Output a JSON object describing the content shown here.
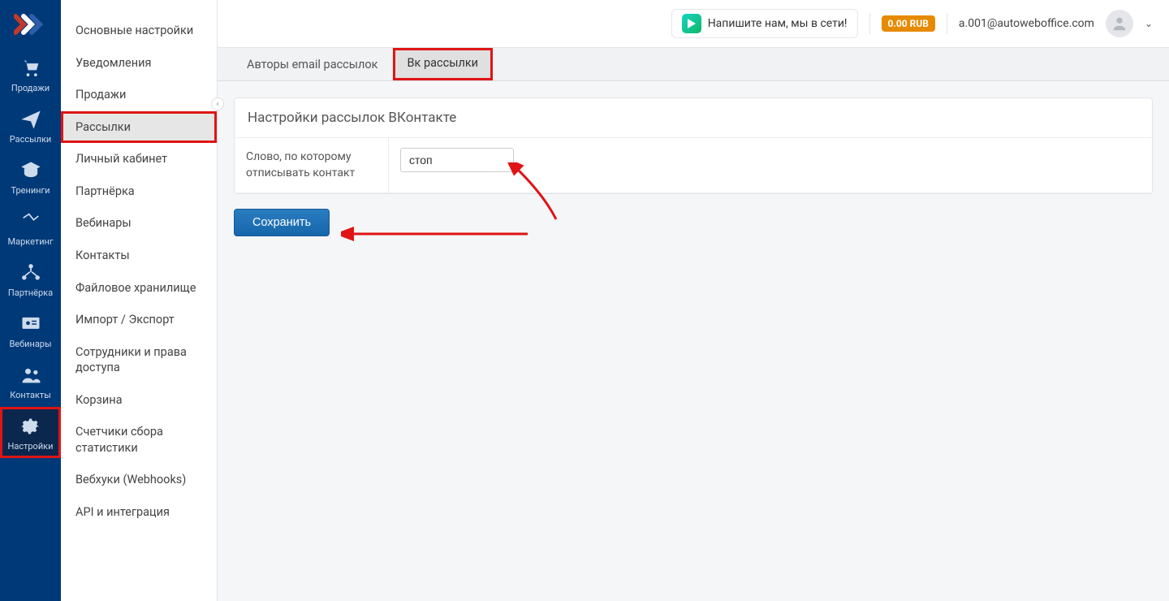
{
  "rail": [
    {
      "id": "sales",
      "label": "Продажи"
    },
    {
      "id": "mailings",
      "label": "Рассылки"
    },
    {
      "id": "trainings",
      "label": "Тренинги"
    },
    {
      "id": "marketing",
      "label": "Маркетинг"
    },
    {
      "id": "partner",
      "label": "Партнёрка"
    },
    {
      "id": "webinars",
      "label": "Вебинары"
    },
    {
      "id": "contacts",
      "label": "Контакты"
    },
    {
      "id": "settings",
      "label": "Настройки"
    }
  ],
  "submenu": [
    "Основные настройки",
    "Уведомления",
    "Продажи",
    "Рассылки",
    "Личный кабинет",
    "Партнёрка",
    "Вебинары",
    "Контакты",
    "Файловое хранилище",
    "Импорт / Экспорт",
    "Сотрудники и права доступа",
    "Корзина",
    "Счетчики сбора статистики",
    "Вебхуки (Webhooks)",
    "API и интеграция"
  ],
  "header": {
    "chat_text": "Напишите нам, мы в сети!",
    "balance": "0.00 RUB",
    "user_email": "a.001@autoweboffice.com"
  },
  "tabs": [
    {
      "label": "Авторы email рассылок",
      "active": false
    },
    {
      "label": "Вк рассылки",
      "active": true
    }
  ],
  "panel": {
    "title": "Настройки рассылок ВКонтакте",
    "field_label": "Слово, по которому отписывать контакт",
    "field_value": "стоп",
    "save_label": "Сохранить"
  },
  "highlights": {
    "rail_active": "settings",
    "submenu_active_index": 3,
    "tab_highlight_index": 1
  }
}
